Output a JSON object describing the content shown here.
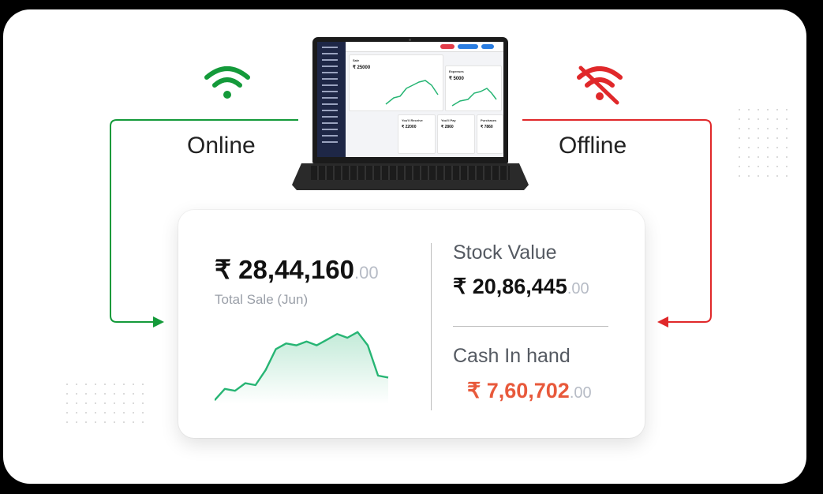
{
  "online": {
    "label": "Online",
    "icon": "wifi-icon",
    "color": "#149a3a"
  },
  "offline": {
    "label": "Offline",
    "icon": "wifi-off-icon",
    "color": "#e0282a"
  },
  "summary": {
    "total_sale": {
      "currency": "₹",
      "amount": "28,44,160",
      "decimals": ".00",
      "label": "Total Sale (Jun)"
    },
    "stock_value": {
      "heading": "Stock Value",
      "currency": "₹",
      "amount": "20,86,445",
      "decimals": ".00"
    },
    "cash_in_hand": {
      "heading": "Cash In hand",
      "currency": "₹",
      "amount": "7,60,702",
      "decimals": ".00",
      "color": "#e8593b"
    }
  },
  "chart_data": {
    "type": "area",
    "values": [
      2,
      8,
      7,
      11,
      10,
      18,
      29,
      32,
      31,
      33,
      31,
      34,
      37,
      35,
      38,
      31,
      15,
      14
    ],
    "color": "#27b574",
    "ylim": [
      0,
      40
    ]
  },
  "laptop_screen": {
    "sale_title": "Sale",
    "sale_amount": "₹ 25000",
    "expenses_title": "Expenses",
    "expenses_amount": "₹ 5000",
    "receive_title": "You'll Receive",
    "receive_amount": "₹ 22000",
    "pay_title": "You'll Pay",
    "pay_amount": "₹ 2860",
    "purchases_title": "Purchases",
    "purchases_amount": "₹ 7860"
  }
}
